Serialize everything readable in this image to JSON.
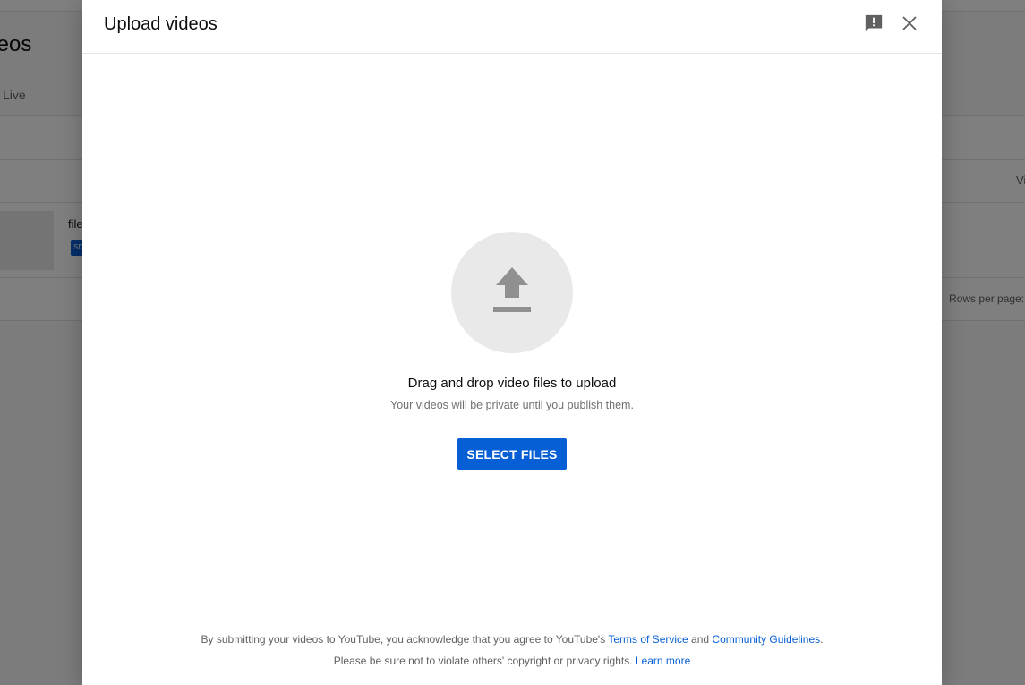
{
  "background": {
    "page_title": "ideos",
    "tab_live": "Live",
    "row_filename": "file",
    "column_views": "Vi",
    "rows_per_page_label": "Rows per page:"
  },
  "dialog": {
    "title": "Upload videos",
    "feedback_icon": "feedback-icon",
    "close_icon": "close-icon",
    "upload_icon": "upload-arrow-icon",
    "drag_text": "Drag and drop video files to upload",
    "private_text": "Your videos will be private until you publish them.",
    "select_button_label": "SELECT FILES",
    "legal": {
      "line1_prefix": "By submitting your videos to YouTube, you acknowledge that you agree to YouTube's ",
      "terms_link": "Terms of Service",
      "and_text": " and ",
      "guidelines_link": "Community Guidelines",
      "line1_suffix": ".",
      "line2_prefix": "Please be sure not to violate others' copyright or privacy rights. ",
      "learn_more_link": "Learn more"
    }
  },
  "colors": {
    "accent": "#065fd4",
    "upload_circle": "#e9e9e9",
    "overlay": "rgba(0,0,0,0.5)"
  }
}
